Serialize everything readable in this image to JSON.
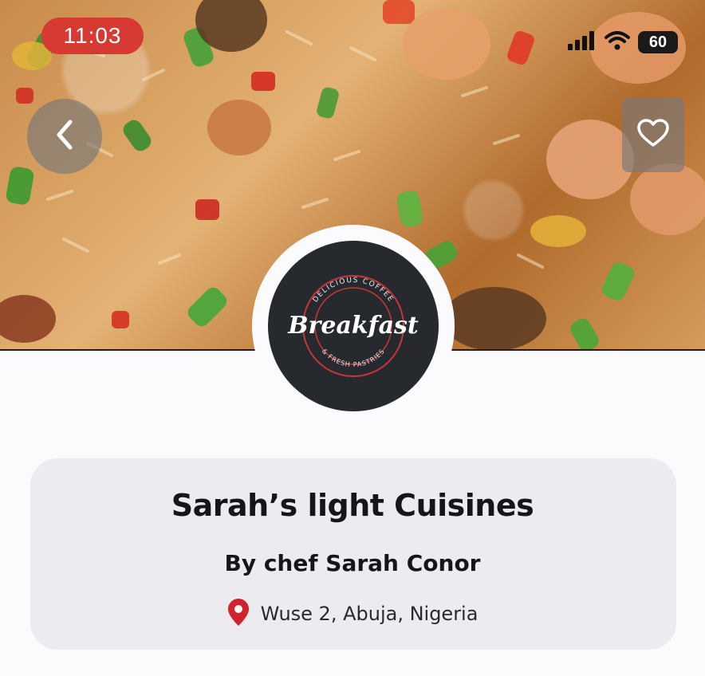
{
  "status_bar": {
    "time": "11:03",
    "battery": "60",
    "icons": [
      "signal-icon",
      "wifi-icon",
      "battery-icon"
    ]
  },
  "header": {
    "back_icon": "chevron-left-icon",
    "favorite_icon": "heart-icon"
  },
  "logo": {
    "arc_top": "DELICIOUS COFFEE",
    "script": "Breakfast",
    "arc_bottom": "& FRESH PASTRIES"
  },
  "restaurant": {
    "name": "Sarah’s light Cuisines",
    "chef": "By chef Sarah Conor",
    "location": "Wuse 2, Abuja, Nigeria",
    "location_icon": "map-pin-icon"
  },
  "colors": {
    "status_pill": "#d63a32",
    "pin": "#d0232e",
    "card_bg": "#ecebf0",
    "logo_bg": "#262a2e"
  }
}
